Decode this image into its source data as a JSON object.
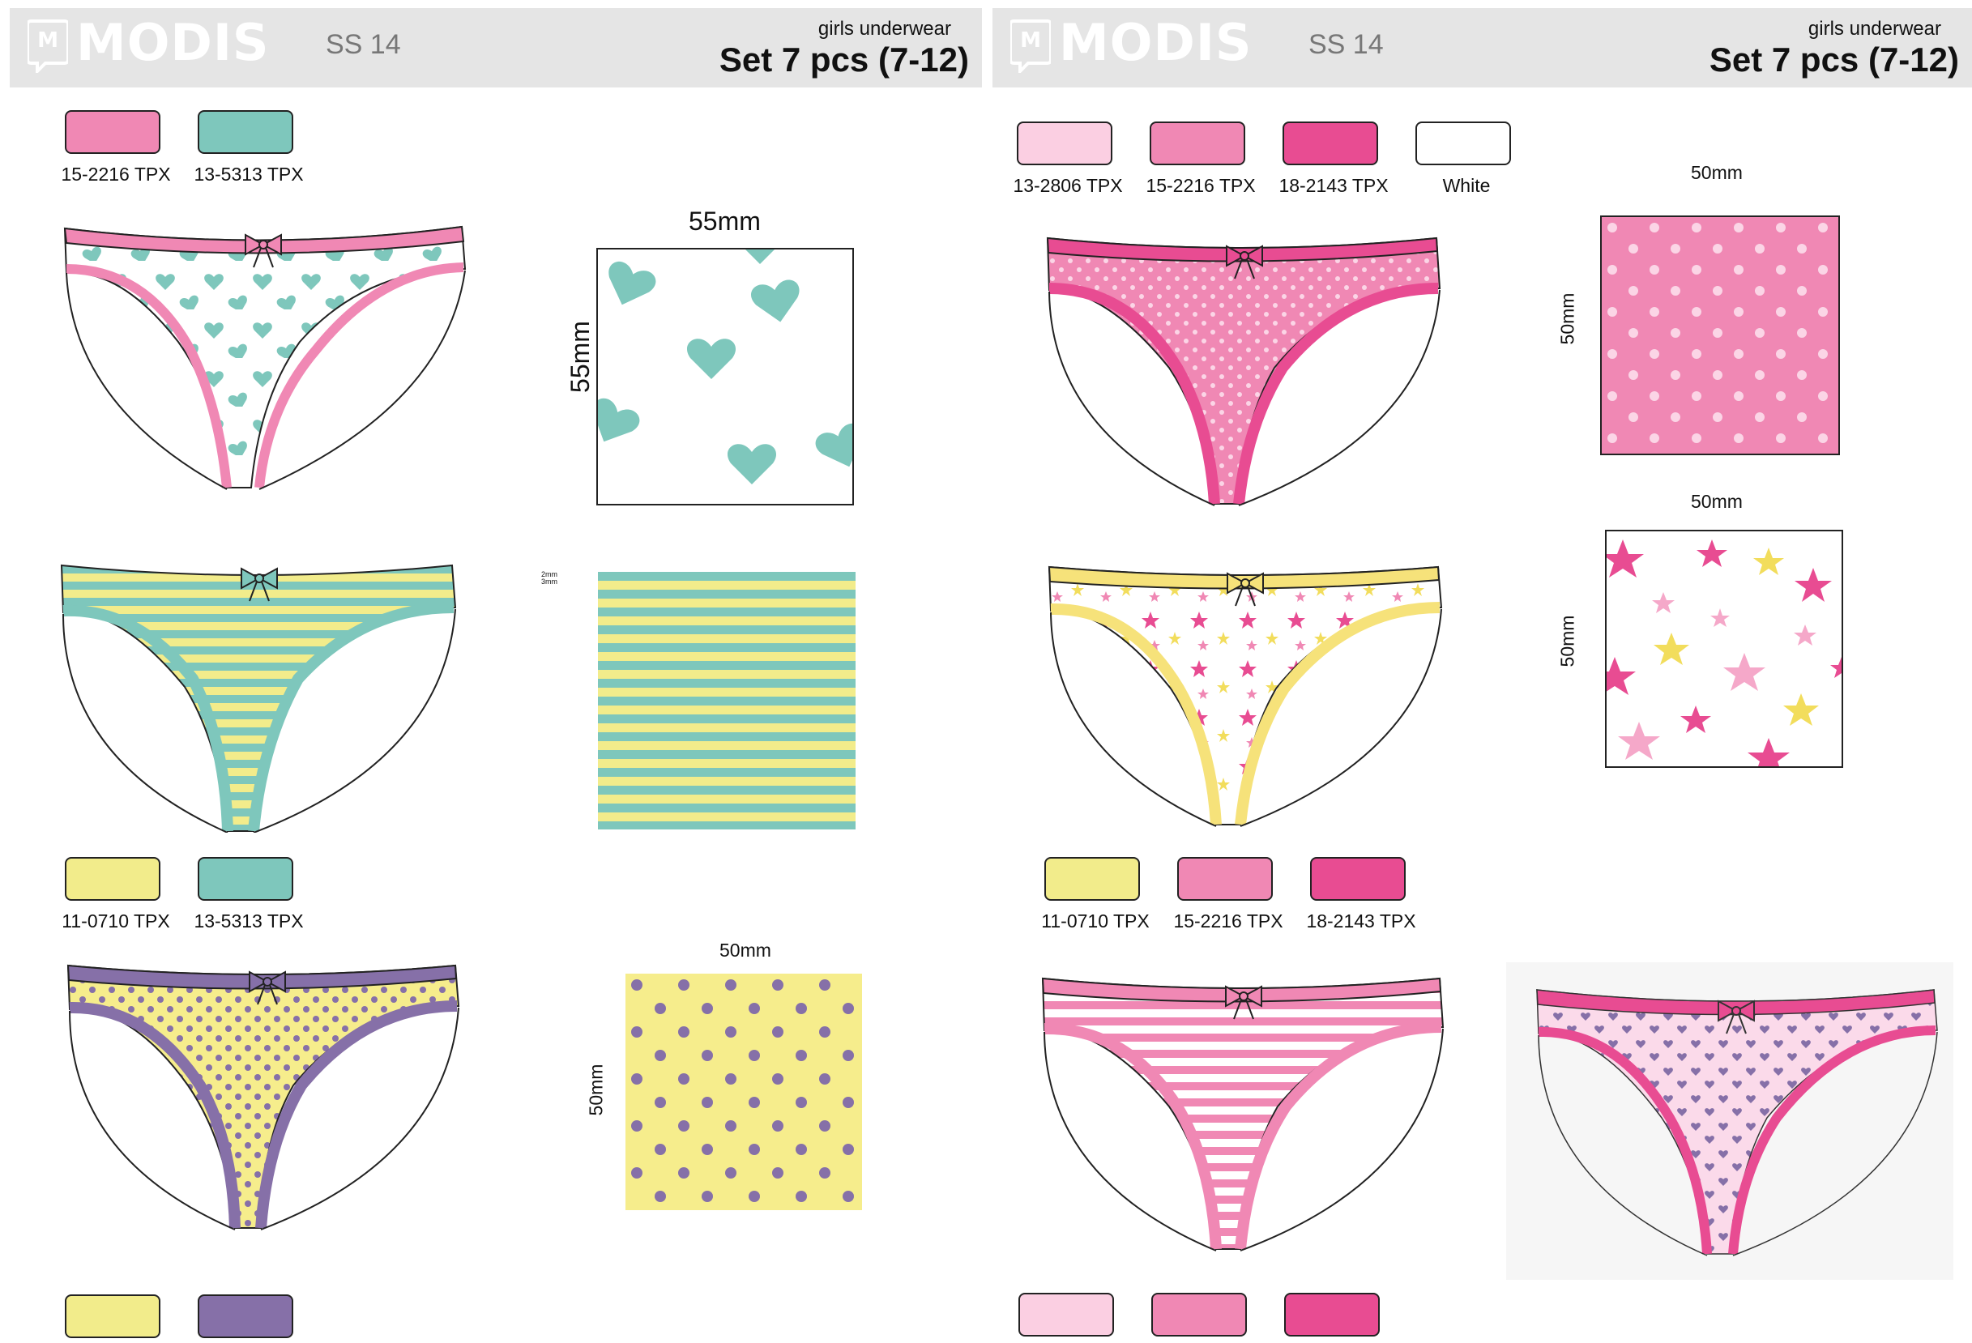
{
  "colors": {
    "pink_15_2216": "#f088b4",
    "mint_13_5313": "#7ec7bc",
    "yellow_11_0710": "#f2ec8b",
    "purple": "#8670a8",
    "light_pink_13_2806": "#fbcfe2",
    "hot_pink_18_2143": "#e84c92",
    "white": "#ffffff",
    "header_bg": "#e5e5e5"
  },
  "left": {
    "header": {
      "brand": "MODIS",
      "season": "SS 14",
      "category": "girls underwear",
      "title": "Set 7 pcs (7-12)"
    },
    "swatches_1": [
      {
        "code": "15-2216 TPX",
        "color": "#f088b4"
      },
      {
        "code": "13-5313 TPX",
        "color": "#7ec7bc"
      }
    ],
    "pattern_hearts": {
      "width_label": "55mm",
      "height_label": "55mm",
      "motif": "hearts",
      "colors": [
        "#7ec7bc",
        "#ffffff"
      ]
    },
    "pattern_stripes": {
      "label_a": "2mm",
      "label_b": "3mm",
      "motif": "stripes",
      "colors": [
        "#7ec7bc",
        "#f2ec8b"
      ]
    },
    "swatches_2": [
      {
        "code": "11-0710 TPX",
        "color": "#f2ec8b"
      },
      {
        "code": "13-5313 TPX",
        "color": "#7ec7bc"
      }
    ],
    "pattern_dots": {
      "width_label": "50mm",
      "height_label": "50mm",
      "motif": "polka dots",
      "colors": [
        "#8670a8",
        "#f6ed8c"
      ]
    },
    "swatches_3": [
      {
        "code": "",
        "color": "#f2ec8b"
      },
      {
        "code": "",
        "color": "#8670a8"
      }
    ]
  },
  "right": {
    "header": {
      "brand": "MODIS",
      "season": "SS 14",
      "category": "girls underwear",
      "title": "Set 7 pcs (7-12)"
    },
    "swatches_1": [
      {
        "code": "13-2806 TPX",
        "color": "#fbcfe2"
      },
      {
        "code": "15-2216 TPX",
        "color": "#f088b4"
      },
      {
        "code": "18-2143 TPX",
        "color": "#e84c92"
      },
      {
        "code": "White",
        "color": "#ffffff"
      }
    ],
    "pattern_pink_dots": {
      "width_label": "50mm",
      "height_label": "50mm",
      "motif": "white dots on pink"
    },
    "pattern_stars": {
      "width_label": "50mm",
      "height_label": "50mm",
      "motif": "stars"
    },
    "swatches_2": [
      {
        "code": "11-0710 TPX",
        "color": "#f2ec8b"
      },
      {
        "code": "15-2216 TPX",
        "color": "#f088b4"
      },
      {
        "code": "18-2143 TPX",
        "color": "#e84c92"
      }
    ],
    "swatches_3": [
      {
        "code": "",
        "color": "#fbcfe2"
      },
      {
        "code": "",
        "color": "#f088b4"
      },
      {
        "code": "",
        "color": "#e84c92"
      }
    ]
  }
}
